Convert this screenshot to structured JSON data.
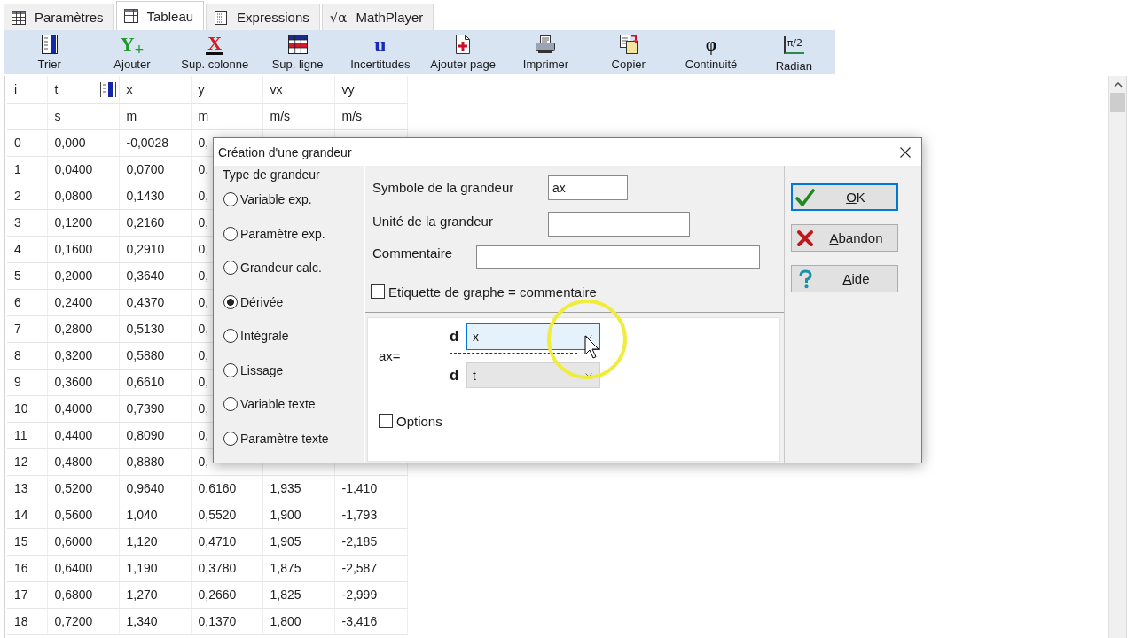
{
  "tabs": [
    {
      "label": "Paramètres",
      "kind": "table",
      "selected": false
    },
    {
      "label": "Tableau",
      "kind": "table",
      "selected": true
    },
    {
      "label": "Expressions",
      "kind": "document",
      "selected": false
    },
    {
      "label": "MathPlayer",
      "kind": "glyph",
      "glyph": "√α",
      "selected": false
    }
  ],
  "toolbar": [
    {
      "label": "Trier",
      "kind": "sort"
    },
    {
      "label": "Ajouter",
      "kind": "add",
      "glyph": "Y$_{+}$"
    },
    {
      "label": "Sup. colonne",
      "kind": "delcol",
      "glyph": "X"
    },
    {
      "label": "Sup. ligne",
      "kind": "delrow"
    },
    {
      "label": "Incertitudes",
      "kind": "uncert",
      "glyph": "u"
    },
    {
      "label": "Ajouter page",
      "kind": "addpage"
    },
    {
      "label": "Imprimer",
      "kind": "print"
    },
    {
      "label": "Copier",
      "kind": "copy"
    },
    {
      "label": "Continuité",
      "kind": "continuity",
      "glyph": "φ"
    },
    {
      "label": "Radian",
      "kind": "radian",
      "glyph": "π/2"
    }
  ],
  "table": {
    "columns": [
      {
        "name": "i",
        "sorted": false
      },
      {
        "name": "t",
        "unit": "s",
        "sorted": true
      },
      {
        "name": "x",
        "unit": "m",
        "sorted": false
      },
      {
        "name": "y",
        "unit": "m",
        "sorted": false
      },
      {
        "name": "vx",
        "unit": "m/s",
        "sorted": false
      },
      {
        "name": "vy",
        "unit": "m/s",
        "sorted": false
      }
    ],
    "rows": [
      [
        "0",
        "0,000",
        "-0,0028",
        "0,"
      ],
      [
        "1",
        "0,0400",
        "0,0700",
        "0,"
      ],
      [
        "2",
        "0,0800",
        "0,1430",
        "0,"
      ],
      [
        "3",
        "0,1200",
        "0,2160",
        "0,"
      ],
      [
        "4",
        "0,1600",
        "0,2910",
        "0,"
      ],
      [
        "5",
        "0,2000",
        "0,3640",
        "0,"
      ],
      [
        "6",
        "0,2400",
        "0,4370",
        "0,"
      ],
      [
        "7",
        "0,2800",
        "0,5130",
        "0,"
      ],
      [
        "8",
        "0,3200",
        "0,5880",
        "0,"
      ],
      [
        "9",
        "0,3600",
        "0,6610",
        "0,"
      ],
      [
        "10",
        "0,4000",
        "0,7390",
        "0,"
      ],
      [
        "11",
        "0,4400",
        "0,8090",
        "0,"
      ],
      [
        "12",
        "0,4800",
        "0,8880",
        "0,"
      ],
      [
        "13",
        "0,5200",
        "0,9640",
        "0,6160",
        "1,935",
        "-1,410"
      ],
      [
        "14",
        "0,5600",
        "1,040",
        "0,5520",
        "1,900",
        "-1,793"
      ],
      [
        "15",
        "0,6000",
        "1,120",
        "0,4710",
        "1,905",
        "-2,185"
      ],
      [
        "16",
        "0,6400",
        "1,190",
        "0,3780",
        "1,875",
        "-2,587"
      ],
      [
        "17",
        "0,6800",
        "1,270",
        "0,2660",
        "1,825",
        "-2,999"
      ],
      [
        "18",
        "0,7200",
        "1,340",
        "0,1370",
        "1,800",
        "-3,416"
      ]
    ]
  },
  "dialog": {
    "title": "Création d'une grandeur",
    "group_title": "Type de grandeur",
    "types": [
      {
        "label": "Variable exp.",
        "selected": false
      },
      {
        "label": "Paramètre exp.",
        "selected": false
      },
      {
        "label": "Grandeur calc.",
        "selected": false
      },
      {
        "label": "Dérivée",
        "selected": true
      },
      {
        "label": "Intégrale",
        "selected": false
      },
      {
        "label": "Lissage",
        "selected": false
      },
      {
        "label": "Variable texte",
        "selected": false
      },
      {
        "label": "Paramètre texte",
        "selected": false
      }
    ],
    "fields": [
      {
        "label": "Symbole de la grandeur",
        "value": "ax"
      },
      {
        "label": "Unité de la grandeur"
      },
      {
        "label": "Commentaire"
      }
    ],
    "graph_label": {
      "label": "Etiquette de graphe = commentaire",
      "checked": false
    },
    "formula": {
      "result": "ax=",
      "numerator": {
        "operator": "d",
        "value": "x",
        "hovered": true
      },
      "denominator": {
        "operator": "d",
        "value": "t",
        "hovered": false
      }
    },
    "options": {
      "label": "Options",
      "checked": false
    },
    "buttons": [
      {
        "kind": "ok",
        "key": "O",
        "rest": "K",
        "default": true
      },
      {
        "kind": "cancel",
        "key": "A",
        "rest": "bandon",
        "default": false
      },
      {
        "kind": "help",
        "key": "A",
        "rest": "ide",
        "default": false
      }
    ]
  }
}
